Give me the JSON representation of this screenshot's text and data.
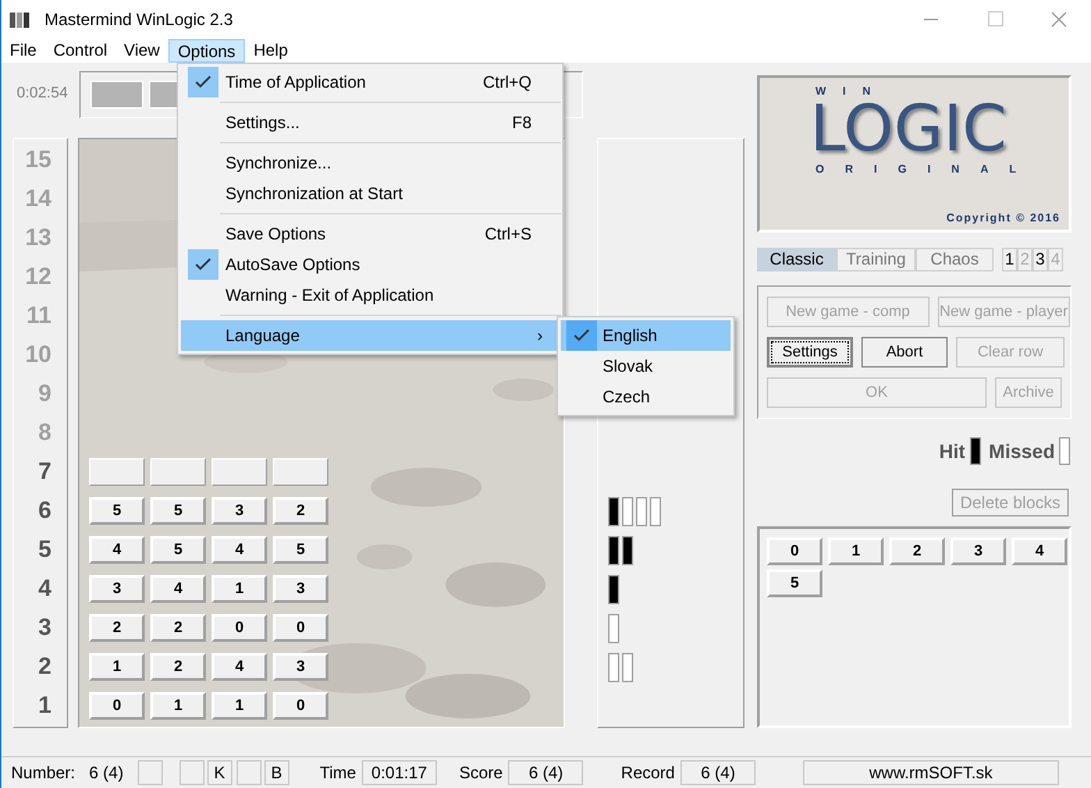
{
  "window": {
    "title": "Mastermind WinLogic 2.3"
  },
  "menu_bar": [
    {
      "label": "File",
      "selected": false
    },
    {
      "label": "Control",
      "selected": false
    },
    {
      "label": "View",
      "selected": false
    },
    {
      "label": "Options",
      "selected": true
    },
    {
      "label": "Help",
      "selected": false
    }
  ],
  "options_menu": [
    {
      "kind": "item",
      "label": "Time of Application",
      "shortcut": "Ctrl+Q",
      "checked": true
    },
    {
      "kind": "separator"
    },
    {
      "kind": "item",
      "label": "Settings...",
      "shortcut": "F8",
      "checked": false
    },
    {
      "kind": "separator"
    },
    {
      "kind": "item",
      "label": "Synchronize...",
      "checked": false
    },
    {
      "kind": "item",
      "label": "Synchronization at Start",
      "checked": false
    },
    {
      "kind": "separator"
    },
    {
      "kind": "item",
      "label": "Save Options",
      "shortcut": "Ctrl+S",
      "checked": false
    },
    {
      "kind": "item",
      "label": "AutoSave Options",
      "checked": true
    },
    {
      "kind": "item",
      "label": "Warning - Exit of Application",
      "checked": false
    },
    {
      "kind": "separator"
    },
    {
      "kind": "submenu",
      "label": "Language",
      "arrow": "›",
      "selected": true
    }
  ],
  "language_menu": [
    {
      "label": "English",
      "checked": true,
      "selected": true
    },
    {
      "label": "Slovak",
      "checked": false,
      "selected": false
    },
    {
      "label": "Czech",
      "checked": false,
      "selected": false
    }
  ],
  "elapsed_time": "0:02:54",
  "rows": [
    {
      "label": "15",
      "active": false
    },
    {
      "label": "14",
      "active": false
    },
    {
      "label": "13",
      "active": false
    },
    {
      "label": "12",
      "active": false
    },
    {
      "label": "11",
      "active": false
    },
    {
      "label": "10",
      "active": false
    },
    {
      "label": "9",
      "active": false
    },
    {
      "label": "8",
      "active": false
    },
    {
      "label": "7",
      "active": true,
      "current": true
    },
    {
      "label": "6",
      "active": true,
      "guess": [
        "5",
        "5",
        "3",
        "2"
      ],
      "pegs": [
        {
          "hit": true
        },
        {
          "hit": false
        },
        {
          "hit": false
        },
        {
          "hit": false
        }
      ]
    },
    {
      "label": "5",
      "active": true,
      "guess": [
        "4",
        "5",
        "4",
        "5"
      ],
      "pegs": [
        {
          "hit": true
        },
        {
          "hit": true
        }
      ]
    },
    {
      "label": "4",
      "active": true,
      "guess": [
        "3",
        "4",
        "1",
        "3"
      ],
      "pegs": [
        {
          "hit": true
        }
      ]
    },
    {
      "label": "3",
      "active": true,
      "guess": [
        "2",
        "2",
        "0",
        "0"
      ],
      "pegs": [
        {
          "hit": false
        }
      ]
    },
    {
      "label": "2",
      "active": true,
      "guess": [
        "1",
        "2",
        "4",
        "3"
      ],
      "pegs": [
        {
          "hit": false
        },
        {
          "hit": false
        }
      ]
    },
    {
      "label": "1",
      "active": true,
      "guess": [
        "0",
        "1",
        "1",
        "0"
      ]
    }
  ],
  "logo": {
    "top": "WIN",
    "main": "LOGIC",
    "bottom": "ORIGINAL",
    "copyright": "Copyright © 2016"
  },
  "modes": [
    {
      "label": "Classic",
      "selected": true
    },
    {
      "label": "Training",
      "selected": false
    },
    {
      "label": "Chaos",
      "selected": false
    }
  ],
  "levels": [
    {
      "label": "1",
      "enabled": true
    },
    {
      "label": "2",
      "enabled": false
    },
    {
      "label": "3",
      "enabled": true
    },
    {
      "label": "4",
      "enabled": false
    }
  ],
  "buttons": [
    [
      {
        "label": "New game - comp",
        "enabled": false
      },
      {
        "label": "New game - player",
        "enabled": false
      }
    ],
    [
      {
        "label": "Settings",
        "enabled": true,
        "focused": true
      },
      {
        "label": "Abort",
        "enabled": true
      },
      {
        "label": "Clear row",
        "enabled": false
      }
    ],
    [
      {
        "label": "OK",
        "enabled": false
      },
      {
        "label": "Archive",
        "enabled": false
      }
    ]
  ],
  "legend": [
    {
      "label": "Hit",
      "hit": true
    },
    {
      "label": "Missed",
      "hit": false
    }
  ],
  "delete_blocks": {
    "label": "Delete blocks",
    "enabled": false
  },
  "digits": [
    "0",
    "1",
    "2",
    "3",
    "4",
    "5"
  ],
  "status_bar": [
    {
      "kind": "label",
      "text": "Number:"
    },
    {
      "kind": "plain",
      "text": "6 (4)"
    },
    {
      "kind": "box"
    },
    {
      "kind": "box"
    },
    {
      "kind": "box",
      "text": "K"
    },
    {
      "kind": "box"
    },
    {
      "kind": "box",
      "text": "B"
    },
    {
      "kind": "label",
      "text": "Time"
    },
    {
      "kind": "box",
      "text": "0:01:17"
    },
    {
      "kind": "label",
      "text": "Score"
    },
    {
      "kind": "box",
      "text": "6 (4)"
    },
    {
      "kind": "label",
      "text": "Record"
    },
    {
      "kind": "box",
      "text": "6 (4)"
    },
    {
      "kind": "wide",
      "text": "www.rmSOFT.sk"
    }
  ]
}
